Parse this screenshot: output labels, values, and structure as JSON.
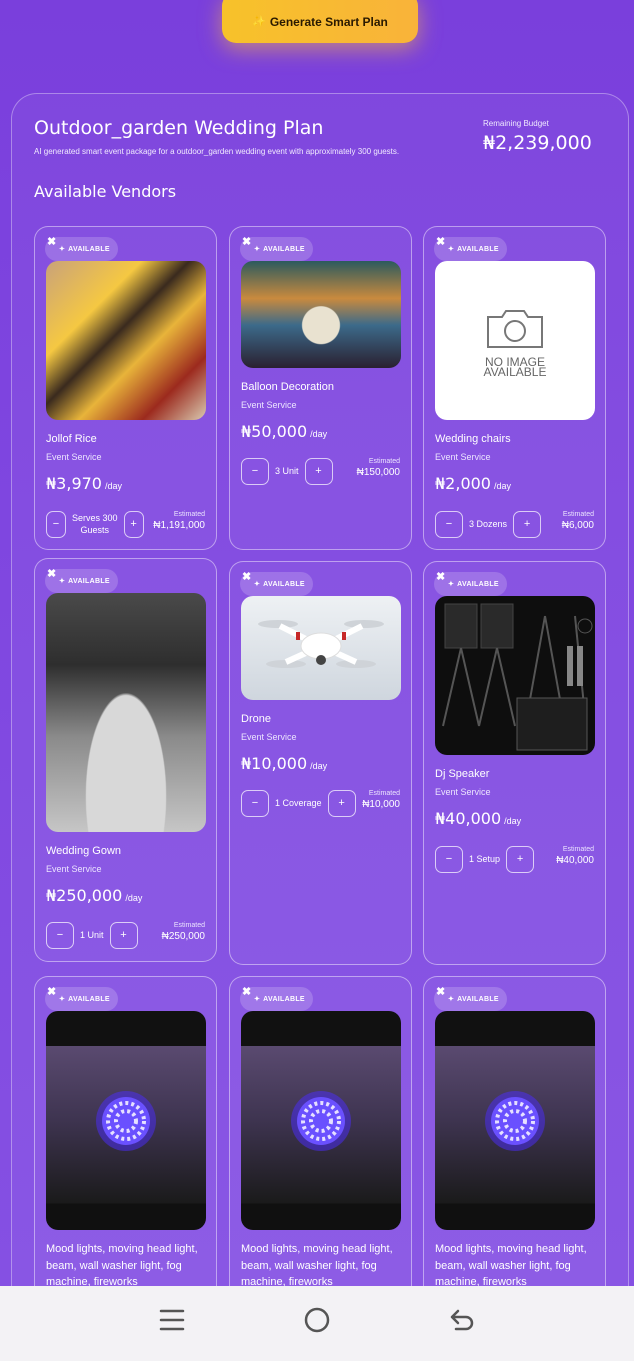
{
  "top_button": {
    "icon": "sparkle-icon",
    "label": "Generate Smart Plan"
  },
  "plan": {
    "title": "Outdoor_garden Wedding Plan",
    "subtitle": "AI generated smart event package for a outdoor_garden wedding event with approximately 300 guests.",
    "budget_label": "Remaining Budget",
    "budget_value": "₦2,239,000"
  },
  "section_title": "Available Vendors",
  "badge_label": "AVAILABLE",
  "estimated_label": "Estimated",
  "per_day": "/day",
  "vendors": [
    {
      "name": "Jollof Rice",
      "category": "Event Service",
      "price": "₦3,970",
      "qty_line1": "Serves 300",
      "qty_line2": "Guests",
      "estimated": "₦1,191,000"
    },
    {
      "name": "Balloon Decoration",
      "category": "Event Service",
      "price": "₦50,000",
      "qty_line1": "3 Unit",
      "estimated": "₦150,000"
    },
    {
      "name": "Wedding chairs",
      "category": "Event Service",
      "price": "₦2,000",
      "qty_line1": "3 Dozens",
      "estimated": "₦6,000",
      "image_text": "NO IMAGE AVAILABLE"
    },
    {
      "name": "Wedding Gown",
      "category": "Event Service",
      "price": "₦250,000",
      "qty_line1": "1 Unit",
      "estimated": "₦250,000"
    },
    {
      "name": "Drone",
      "category": "Event Service",
      "price": "₦10,000",
      "qty_line1": "1 Coverage",
      "estimated": "₦10,000"
    },
    {
      "name": "Dj Speaker",
      "category": "Event Service",
      "price": "₦40,000",
      "qty_line1": "1 Setup",
      "estimated": "₦40,000"
    },
    {
      "description": "Mood lights, moving head light, beam, wall washer light, fog machine, fireworks"
    },
    {
      "description": "Mood lights, moving head light, beam, wall washer light, fog machine, fireworks"
    },
    {
      "description": "Mood lights, moving head light, beam, wall washer light, fog machine, fireworks"
    }
  ],
  "stepper": {
    "minus": "−",
    "plus": "+"
  },
  "nav": {
    "menu": "recent-apps-icon",
    "home": "home-icon",
    "back": "back-icon"
  },
  "colors": {
    "background": "#7c44dd",
    "button": "#f7c22a",
    "navbar": "#f3f2f5"
  }
}
